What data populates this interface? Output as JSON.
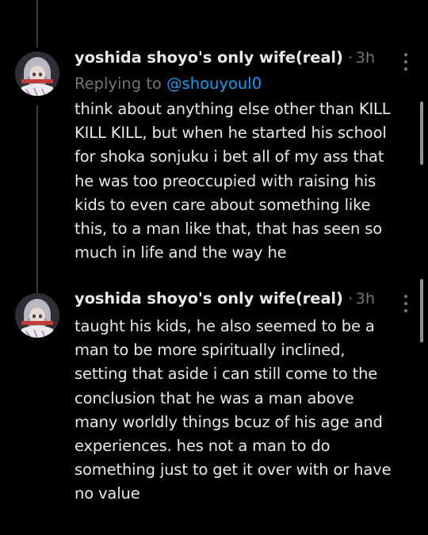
{
  "tweets": [
    {
      "display_name": "yoshida shoyo's only wife(real)",
      "separator": "·",
      "timestamp": "3h",
      "reply_prefix": "Replying to ",
      "reply_handle": "@shouyoul0",
      "text": "think about anything else other than KILL\nKILL KILL, but when he started his school\nfor shoka sonjuku i bet all of my ass that\nhe was too preoccupied with raising his\nkids to even care about something like\nthis, to a man like that, that has seen so\nmuch in life and the way he"
    },
    {
      "display_name": "yoshida shoyo's only wife(real)",
      "separator": "·",
      "timestamp": "3h",
      "text": "taught his kids, he also seemed to be a\nman to be more spiritually inclined,\nsetting that aside i can still come to the\nconclusion that he was a man above\nmany worldly things bcuz of his age and\nexperiences. hes not a man to do\nsomething just to get it over with or have\nno value"
    }
  ],
  "icons": {
    "more": "more-dots-icon",
    "avatar": "avatar-anime-girl"
  },
  "colors": {
    "background": "#000000",
    "primary_text": "#e7e9ea",
    "secondary_text": "#71767b",
    "link": "#1d9bf0",
    "thread_line": "#3a3d41"
  }
}
